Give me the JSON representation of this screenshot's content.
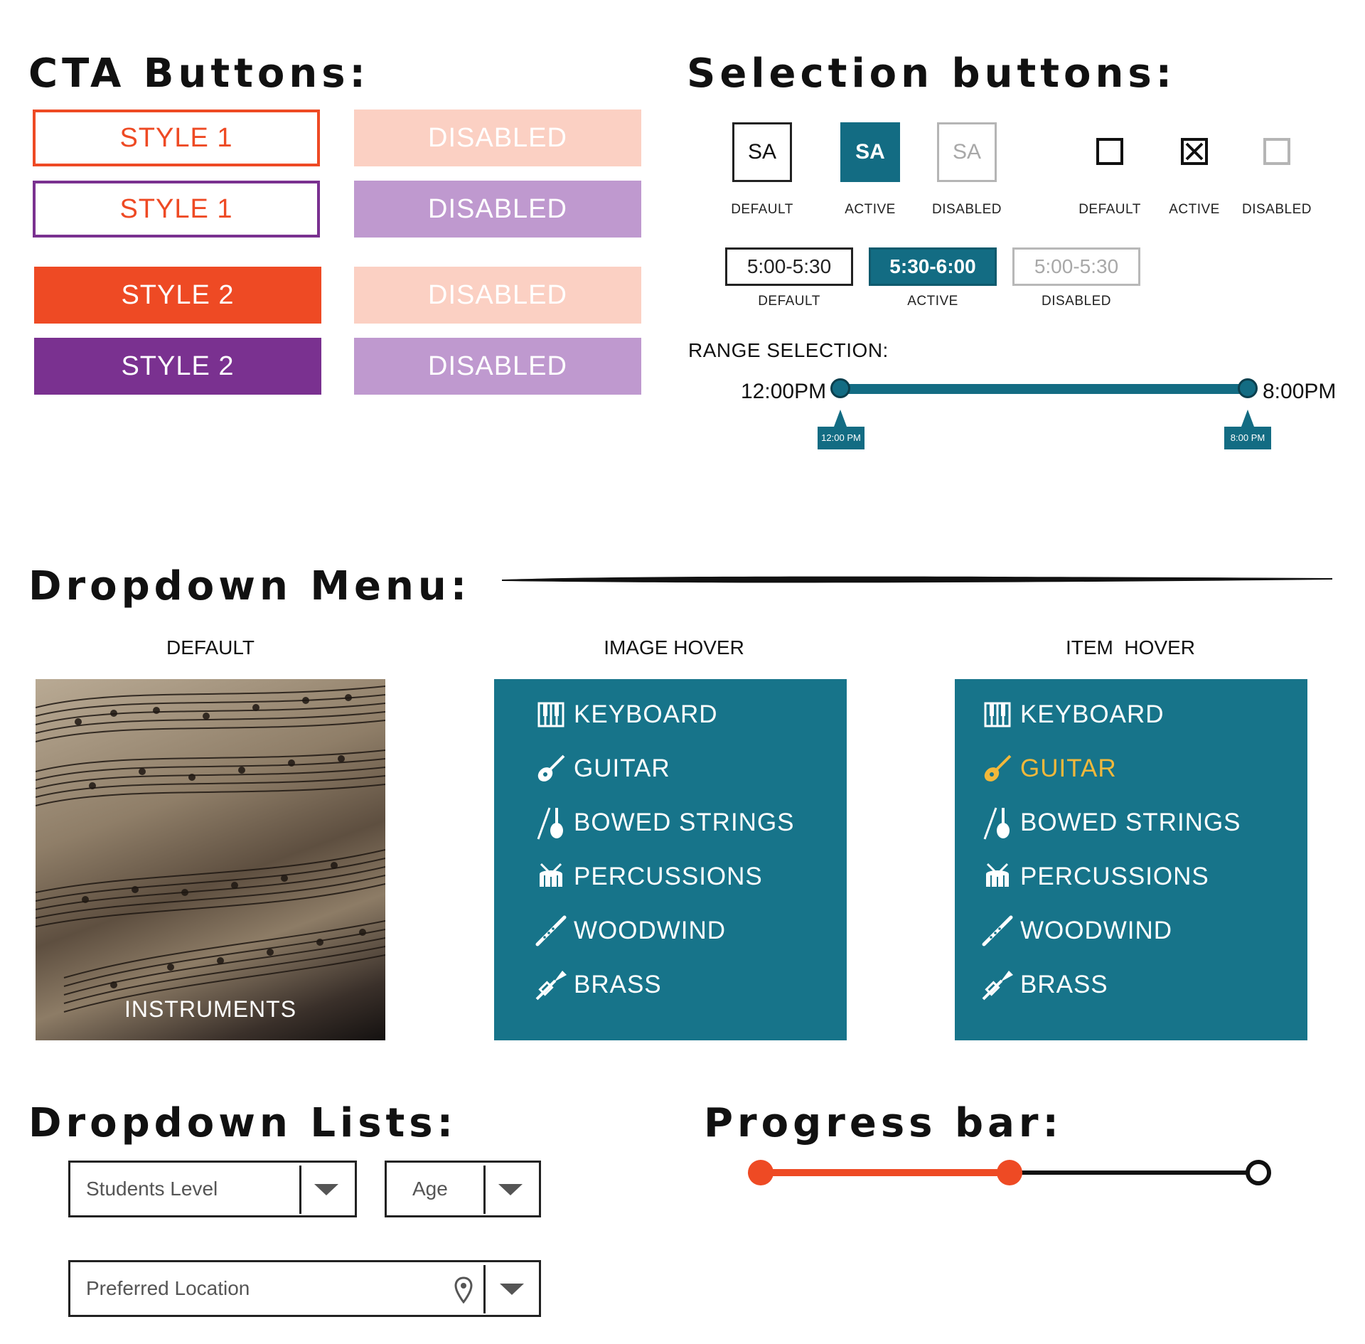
{
  "cta": {
    "title": "CTA Buttons:",
    "style1_outline_orange": "STYLE 1",
    "style1_outline_purple": "STYLE 1",
    "style2_orange": "STYLE 2",
    "style2_purple": "STYLE 2",
    "disabled_1": "DISABLED",
    "disabled_2": "DISABLED",
    "disabled_3": "DISABLED",
    "disabled_4": "DISABLED",
    "colors": {
      "orange": "#ee4a24",
      "purple": "#7a3190",
      "orange_disabled": "#fbd0c3",
      "purple_disabled": "#bf99cf"
    }
  },
  "selection": {
    "title": "Selection buttons:",
    "sa_default": "SA",
    "sa_active": "SA",
    "sa_disabled": "SA",
    "sa_default_caption": "DEFAULT",
    "sa_active_caption": "ACTIVE",
    "sa_disabled_caption": "DISABLED",
    "check_default_caption": "DEFAULT",
    "check_active_caption": "ACTIVE",
    "check_disabled_caption": "DISABLED",
    "time_default": "5:00-5:30",
    "time_active": "5:30-6:00",
    "time_disabled": "5:00-5:30",
    "time_default_caption": "DEFAULT",
    "time_active_caption": "ACTIVE",
    "time_disabled_caption": "DISABLED",
    "accent": "#136c83"
  },
  "range": {
    "title": "RANGE SELECTION:",
    "min_label": "12:00PM",
    "max_label": "8:00PM",
    "min_tooltip": "12:00 PM",
    "max_tooltip": "8:00 PM"
  },
  "dropdown_menu": {
    "title": "Dropdown Menu:",
    "default_caption": "DEFAULT",
    "image_hover_caption": "IMAGE HOVER",
    "item_hover_caption": "ITEM  HOVER",
    "image_label": "INSTRUMENTS",
    "hover_color": "#f2b83b",
    "items": [
      {
        "label": "KEYBOARD",
        "icon": "keyboard-icon"
      },
      {
        "label": "GUITAR",
        "icon": "guitar-icon"
      },
      {
        "label": "BOWED STRINGS",
        "icon": "violin-icon"
      },
      {
        "label": "PERCUSSIONS",
        "icon": "drum-icon"
      },
      {
        "label": "WOODWIND",
        "icon": "flute-icon"
      },
      {
        "label": "BRASS",
        "icon": "trumpet-icon"
      }
    ],
    "items_hover": [
      {
        "label": "KEYBOARD",
        "icon": "keyboard-icon"
      },
      {
        "label": "GUITAR",
        "icon": "guitar-icon"
      },
      {
        "label": "BOWED STRINGS",
        "icon": "violin-icon"
      },
      {
        "label": "PERCUSSIONS",
        "icon": "drum-icon"
      },
      {
        "label": "WOODWIND",
        "icon": "flute-icon"
      },
      {
        "label": "BRASS",
        "icon": "trumpet-icon"
      }
    ]
  },
  "dropdown_lists": {
    "title": "Dropdown Lists:",
    "students_level": "Students Level",
    "age": "Age",
    "preferred_location": "Preferred Location"
  },
  "progress": {
    "title": "Progress bar:",
    "steps_total": 3,
    "steps_completed": 2,
    "color": "#ee4a24"
  }
}
